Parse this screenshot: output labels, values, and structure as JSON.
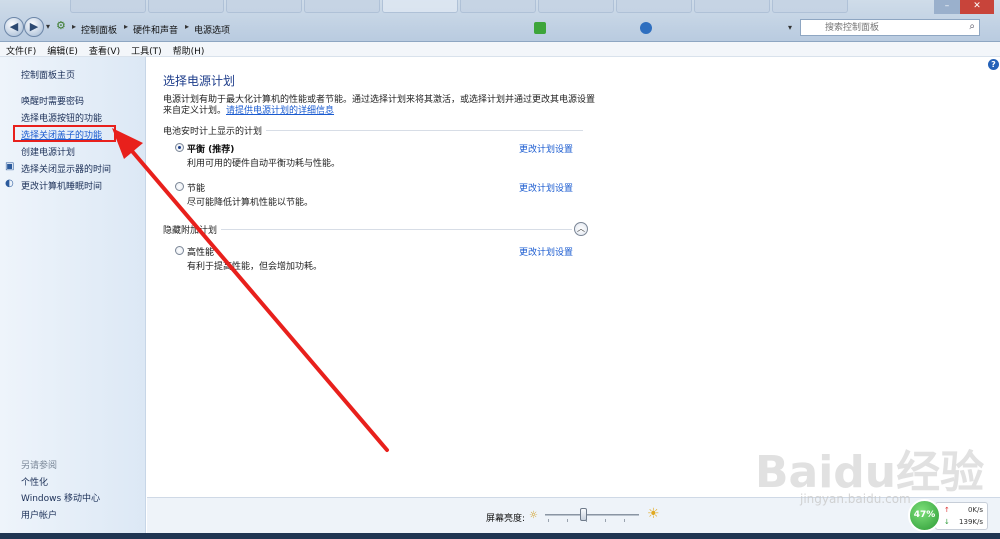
{
  "breadcrumb": [
    "控制面板",
    "硬件和声音",
    "电源选项"
  ],
  "search": {
    "placeholder": "搜索控制面板"
  },
  "menu": [
    "文件(F)",
    "编辑(E)",
    "查看(V)",
    "工具(T)",
    "帮助(H)"
  ],
  "sidebar": {
    "home": "控制面板主页",
    "items": [
      {
        "label": "唤醒时需要密码"
      },
      {
        "label": "选择电源按钮的功能"
      },
      {
        "label": "选择关闭盖子的功能"
      },
      {
        "label": "创建电源计划"
      },
      {
        "label": "选择关闭显示器的时间"
      },
      {
        "label": "更改计算机睡眠时间"
      }
    ],
    "see_also": "另请参阅",
    "see_also_items": [
      "个性化",
      "Windows 移动中心",
      "用户帐户"
    ]
  },
  "main": {
    "title": "选择电源计划",
    "desc_line1": "电源计划有助于最大化计算机的性能或者节能。通过选择计划来将其激活，或选择计划并通过更改其电源设置",
    "desc_line2": "来自定义计划。",
    "desc_link": "请提供电源计划的详细信息",
    "section1": "电池安时计上显示的计划",
    "section2": "隐藏附加计划",
    "plans": [
      {
        "name": "平衡 (推荐)",
        "desc": "利用可用的硬件自动平衡功耗与性能。",
        "link": "更改计划设置",
        "selected": true
      },
      {
        "name": "节能",
        "desc": "尽可能降低计算机性能以节能。",
        "link": "更改计划设置",
        "selected": false
      },
      {
        "name": "高性能",
        "desc": "有利于提高性能，但会增加功耗。",
        "link": "更改计划设置",
        "selected": false
      }
    ]
  },
  "brightness": {
    "label": "屏幕亮度:",
    "level": 0.4
  },
  "network": {
    "percent": "47%",
    "up": "0K/s",
    "down": "139K/s"
  },
  "watermark": {
    "text": "Baidu经验",
    "url": "jingyan.baidu.com"
  },
  "colors": {
    "annotation": "#e8201c",
    "link": "#1a5bd0",
    "title": "#1d3c8a"
  }
}
